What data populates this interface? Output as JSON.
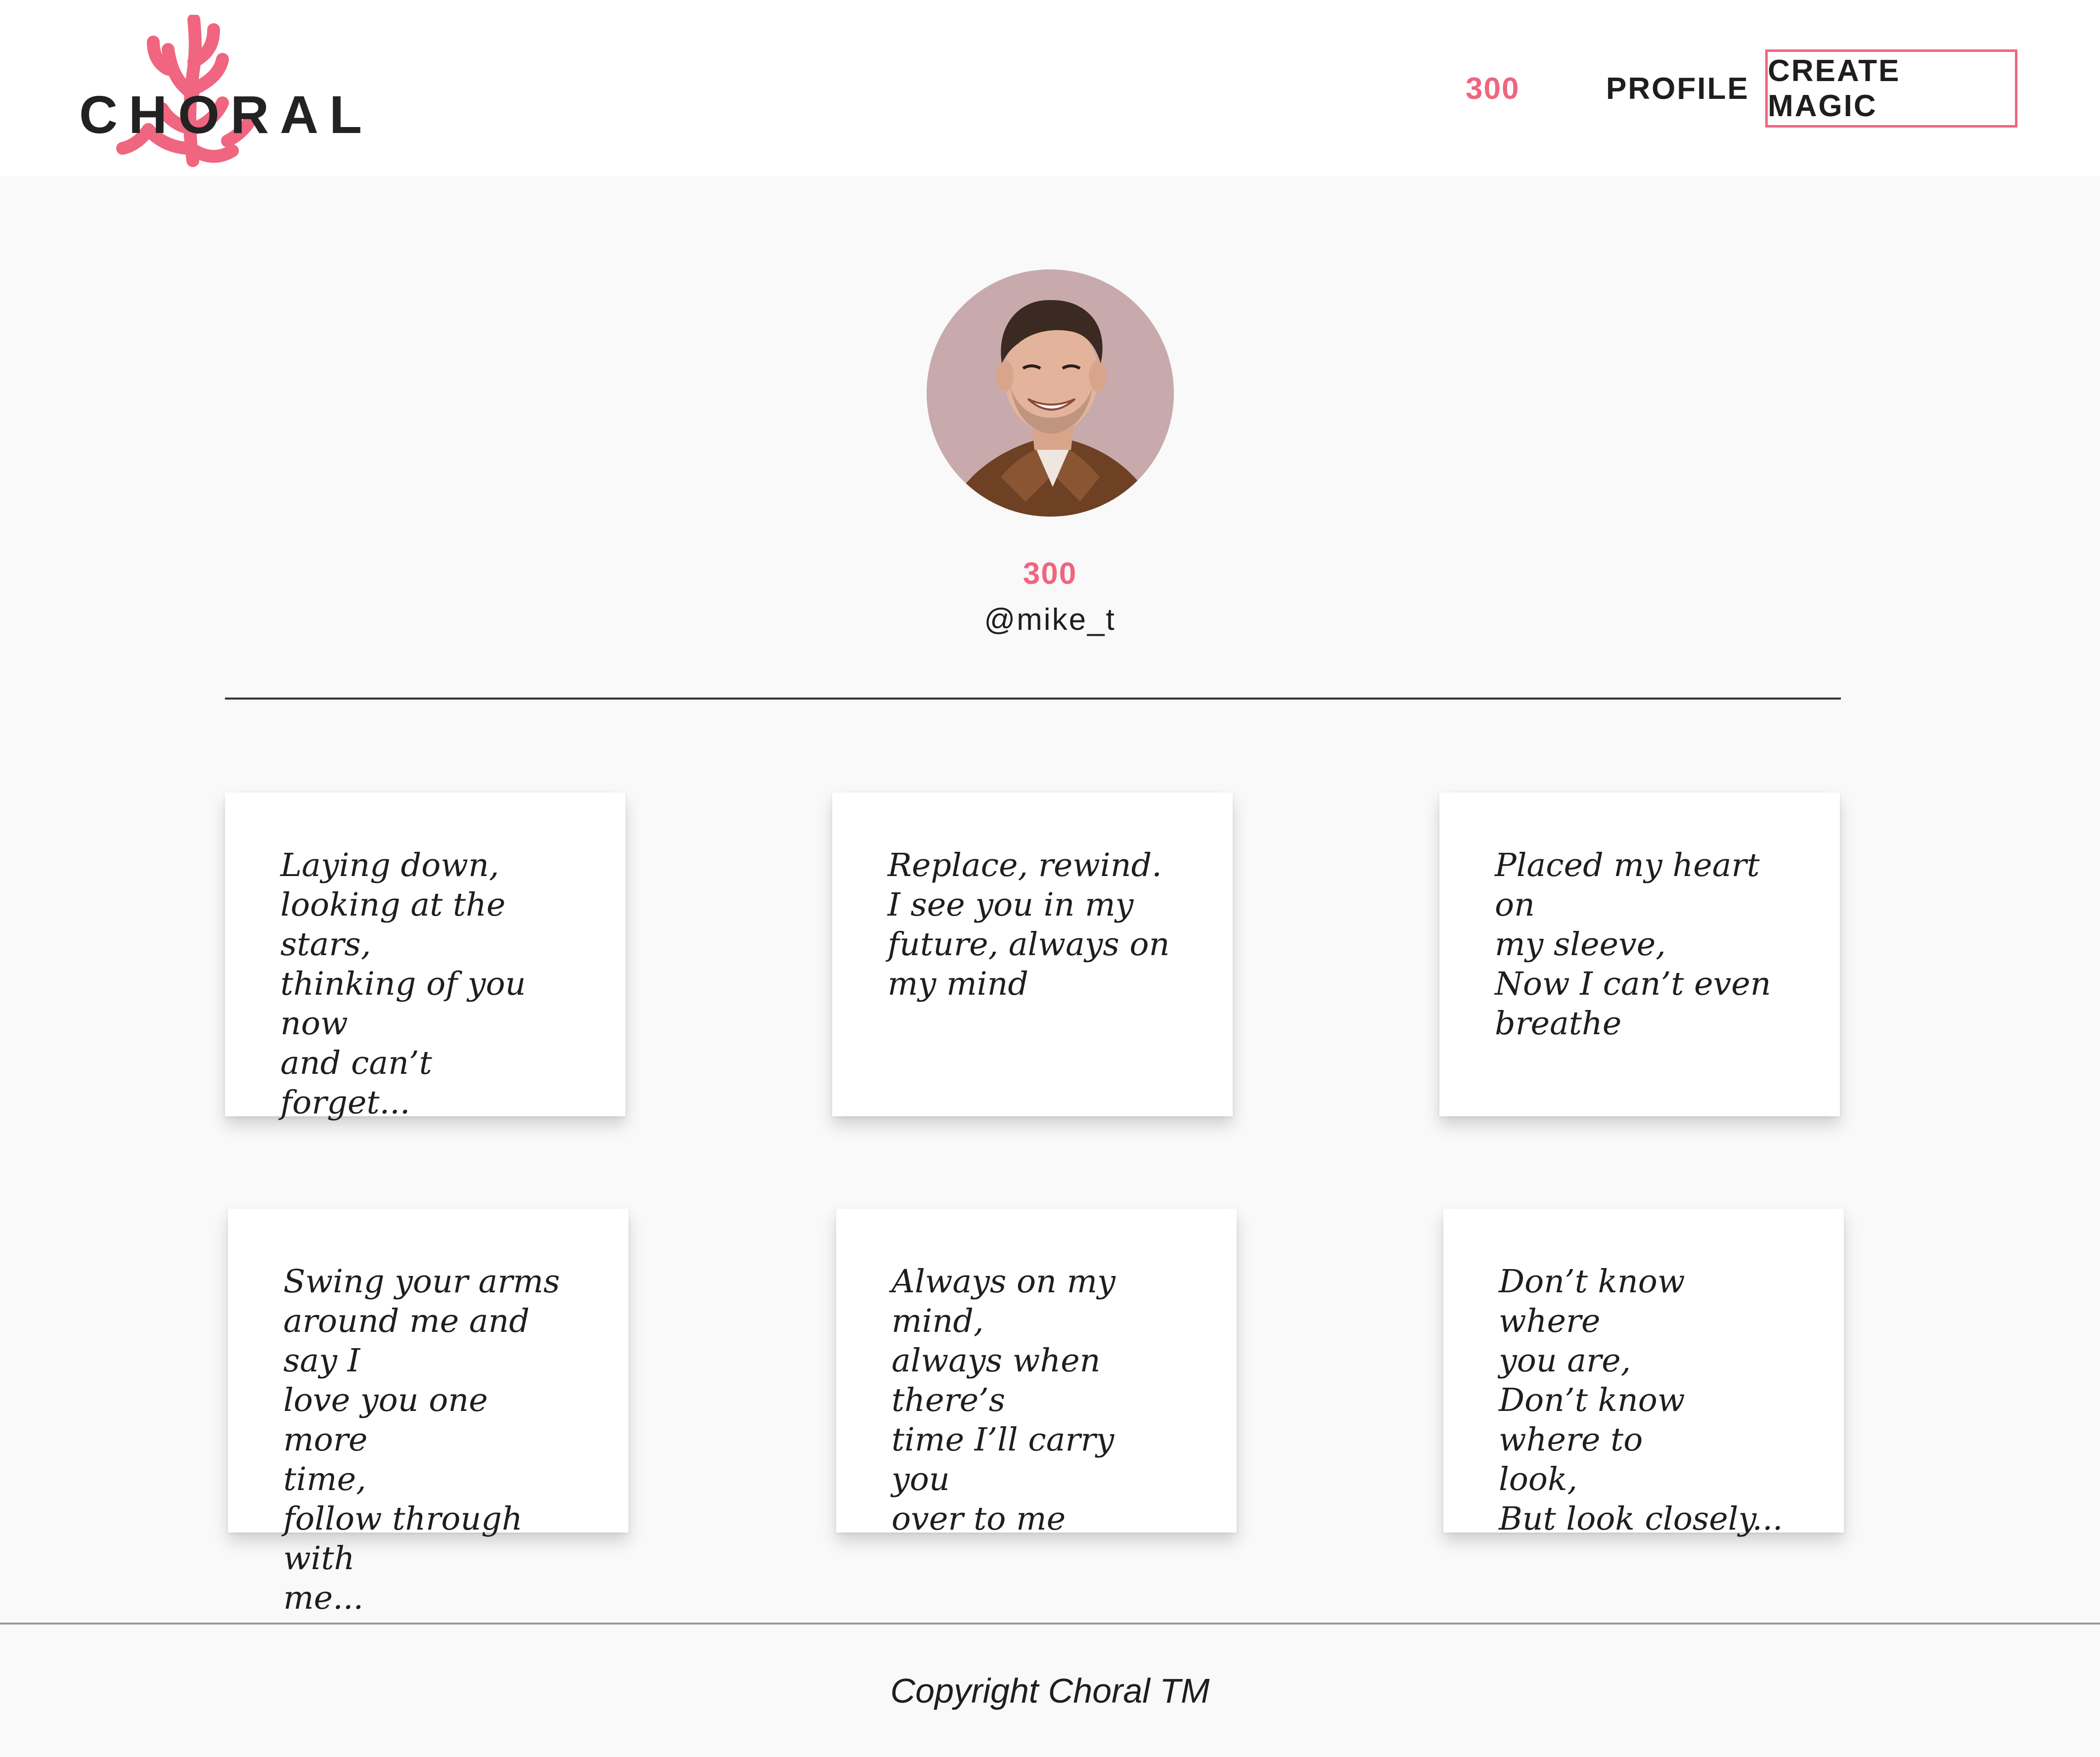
{
  "brand": {
    "name": "CHORAL",
    "accent": "#f0657f"
  },
  "nav": {
    "points": "300",
    "profile_label": "PROFILE",
    "create_label": "CREATE MAGIC"
  },
  "profile": {
    "points": "300",
    "username": "@mike_t"
  },
  "poems": [
    {
      "text": "Laying down,\nlooking at the stars,\nthinking of you now\nand can’t forget..."
    },
    {
      "text": "Replace, rewind.\nI see you in my\nfuture, always on\nmy mind"
    },
    {
      "text": "Placed my heart on\nmy sleeve,\nNow I can’t even\nbreathe"
    },
    {
      "text": "Swing your arms\naround me and say I\nlove you one more\ntime,\nfollow through with\nme..."
    },
    {
      "text": "Always on my mind,\nalways when there’s\ntime I’ll carry you\nover to me"
    },
    {
      "text": "Don’t know where\nyou are,\nDon’t know where to\nlook,\nBut look closely..."
    }
  ],
  "footer": {
    "copyright": "Copyright Choral TM"
  }
}
